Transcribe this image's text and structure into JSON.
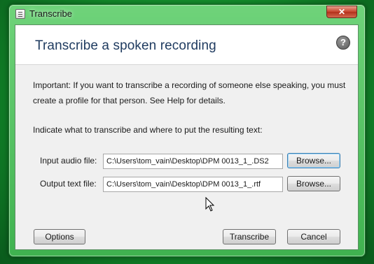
{
  "window": {
    "title": "Transcribe",
    "close_glyph": "✕"
  },
  "dialog": {
    "heading": "Transcribe a spoken recording",
    "help_glyph": "?",
    "important_line1": "Important: If you want to transcribe a recording of someone else speaking, you must",
    "important_line2": "create a profile for that person. See Help for details.",
    "instruction": "Indicate what to transcribe and where to put the resulting text:",
    "input": {
      "label": "Input audio file:",
      "value": "C:\\Users\\tom_vain\\Desktop\\DPM 0013_1_.DS2",
      "browse_label": "Browse..."
    },
    "output": {
      "label": "Output text file:",
      "value": "C:\\Users\\tom_vain\\Desktop\\DPM 0013_1_.rtf",
      "browse_label": "Browse..."
    },
    "buttons": {
      "options": "Options",
      "transcribe": "Transcribe",
      "cancel": "Cancel"
    }
  },
  "icons": {
    "app": "document-icon",
    "close": "close-icon",
    "help": "help-icon",
    "cursor": "mouse-pointer-icon"
  },
  "colors": {
    "title_bar_tint": "#4fbf5e",
    "heading": "#1e3a5f",
    "close_button": "#c7442b",
    "focus_border": "#3c7fb1"
  }
}
